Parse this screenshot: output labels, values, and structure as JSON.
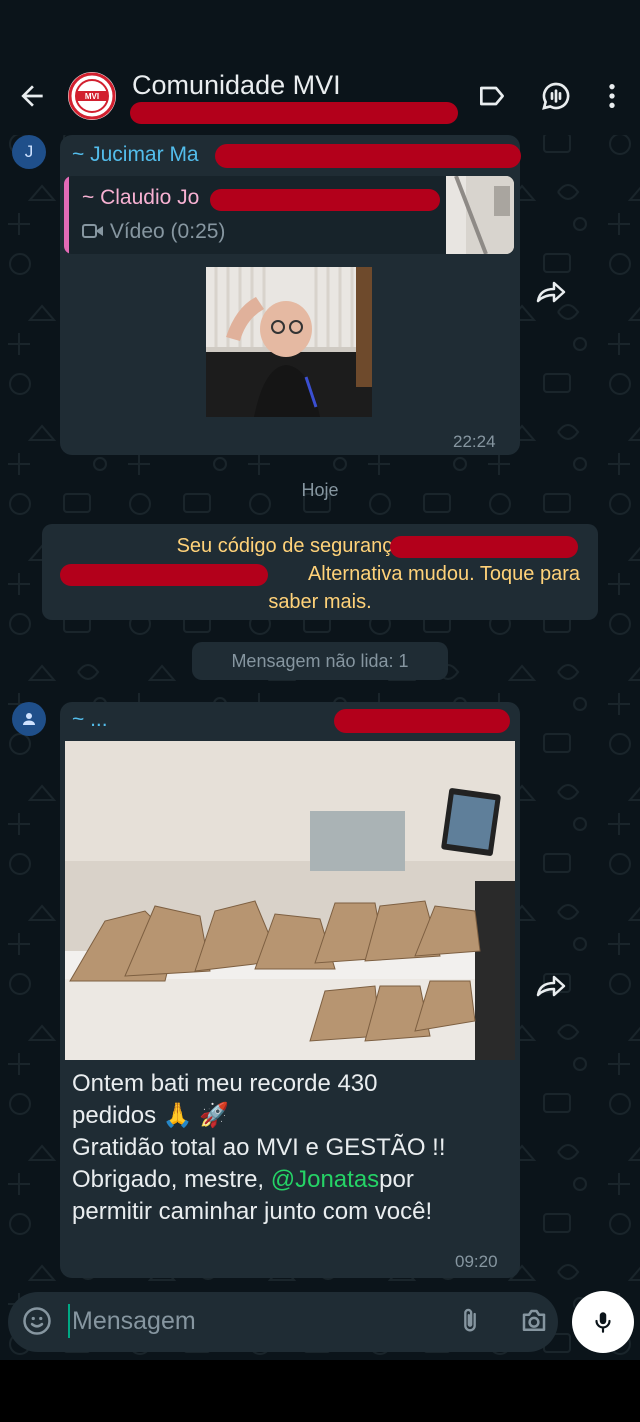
{
  "header": {
    "title": "Comunidade MVI",
    "subtitle": "...",
    "logo_text": "MVI",
    "icons": [
      "back-arrow-icon",
      "label-icon",
      "voice-chat-icon",
      "more-vert-icon"
    ]
  },
  "messages": [
    {
      "avatar_letter": "J",
      "sender": "~ Jucimar Ma",
      "quoted": {
        "sender": "~ Claudio Jo",
        "media_label": "Vídeo (0:25)"
      },
      "time": "22:24"
    },
    {
      "avatar_letter": "",
      "sender": "~ ...",
      "text_lines": [
        "Ontem bati meu recorde 430",
        "pedidos 🙏 🚀",
        "Gratidão total ao MVI e GESTÃO !!"
      ],
      "text_line4_before": "Obrigado, mestre, ",
      "mention": "@Jonatas",
      "text_line4_after": "por",
      "text_line5": "permitir caminhar junto com você!",
      "time": "09:20"
    }
  ],
  "date_separator": "Hoje",
  "security_notice": {
    "line1": "Seu código de segurança com L",
    "line2": "Alternativa mudou. Toque para",
    "line3": "saber mais."
  },
  "unread_separator": "Mensagem não lida: 1",
  "composer": {
    "placeholder": "Mensagem"
  },
  "colors": {
    "background": "#0b141a",
    "bubble": "#1f2c34",
    "sender": "#53bdeb",
    "quote_accent": "#e26ab6",
    "notice": "#ffd279",
    "mention": "#25d366",
    "redaction": "#b3001b"
  }
}
